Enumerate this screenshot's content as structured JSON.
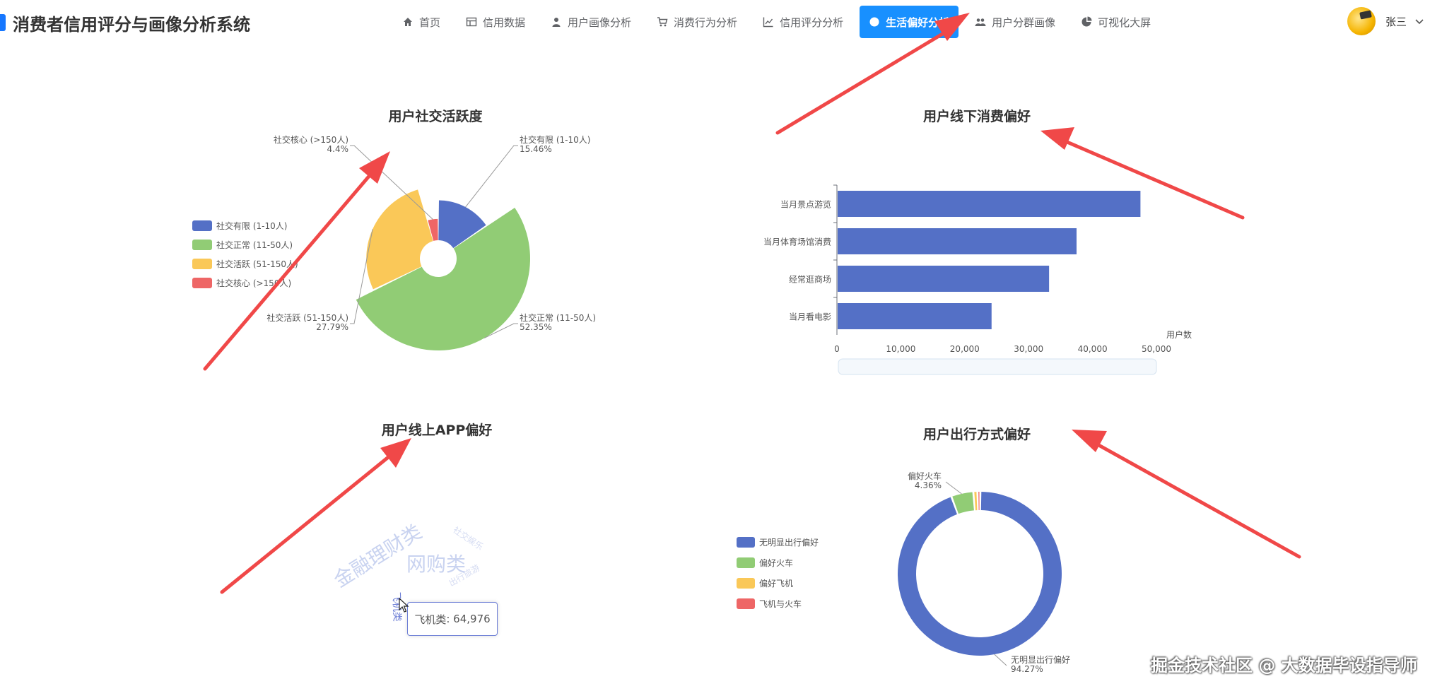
{
  "header": {
    "title": "消费者信用评分与画像分析系统",
    "nav": [
      {
        "label": "首页",
        "icon": "home-icon",
        "active": false
      },
      {
        "label": "信用数据",
        "icon": "table-icon",
        "active": false
      },
      {
        "label": "用户画像分析",
        "icon": "user-icon",
        "active": false
      },
      {
        "label": "消费行为分析",
        "icon": "cart-icon",
        "active": false
      },
      {
        "label": "信用评分分析",
        "icon": "line-chart-icon",
        "active": false
      },
      {
        "label": "生活偏好分析",
        "icon": "circle-icon",
        "active": true
      },
      {
        "label": "用户分群画像",
        "icon": "users-icon",
        "active": false
      },
      {
        "label": "可视化大屏",
        "icon": "pie-chart-icon",
        "active": false
      }
    ],
    "user_name": "张三"
  },
  "tooltip": {
    "label": "飞机类",
    "value": "64,976"
  },
  "watermark": "掘金技术社区 @ 大数据毕设指导师",
  "colors": {
    "primary": "#1890ff",
    "blue": "#5470c6",
    "green": "#91cc75",
    "yellow": "#fac858",
    "red": "#ee6666",
    "arrow": "#f04848"
  },
  "chart_data": [
    {
      "id": "social",
      "type": "pie",
      "rose": true,
      "title": "用户社交活跃度",
      "legend_position": "left",
      "categories": [
        "社交有限 (1-10人)",
        "社交正常 (11-50人)",
        "社交活跃 (51-150人)",
        "社交核心 (>150人)"
      ],
      "percent_labels": [
        "15.46%",
        "52.35%",
        "27.79%",
        "4.4%"
      ],
      "values": [
        15.46,
        52.35,
        27.79,
        4.4
      ]
    },
    {
      "id": "offline",
      "type": "bar",
      "orientation": "horizontal",
      "title": "用户线下消费偏好",
      "categories": [
        "当月景点游览",
        "当月体育场馆消费",
        "经常逛商场",
        "当月看电影"
      ],
      "values": [
        47500,
        37500,
        33200,
        24200
      ],
      "xlabel": "用户数",
      "xlim": [
        0,
        50000
      ],
      "xticks": [
        "0",
        "10,000",
        "20,000",
        "30,000",
        "40,000",
        "50,000"
      ]
    },
    {
      "id": "app",
      "type": "other",
      "subtype": "wordcloud",
      "title": "用户线上APP偏好",
      "words": [
        "金融理财类",
        "网购类",
        "飞机类",
        "社交娱乐",
        "出行旅游"
      ]
    },
    {
      "id": "travel",
      "type": "pie",
      "donut": true,
      "title": "用户出行方式偏好",
      "legend_position": "left",
      "categories": [
        "无明显出行偏好",
        "偏好火车",
        "偏好飞机",
        "飞机与火车"
      ],
      "values": [
        94.27,
        4.36,
        0.8,
        0.57
      ],
      "percent_labels": [
        "94.27%",
        "4.36%",
        "",
        ""
      ]
    }
  ]
}
